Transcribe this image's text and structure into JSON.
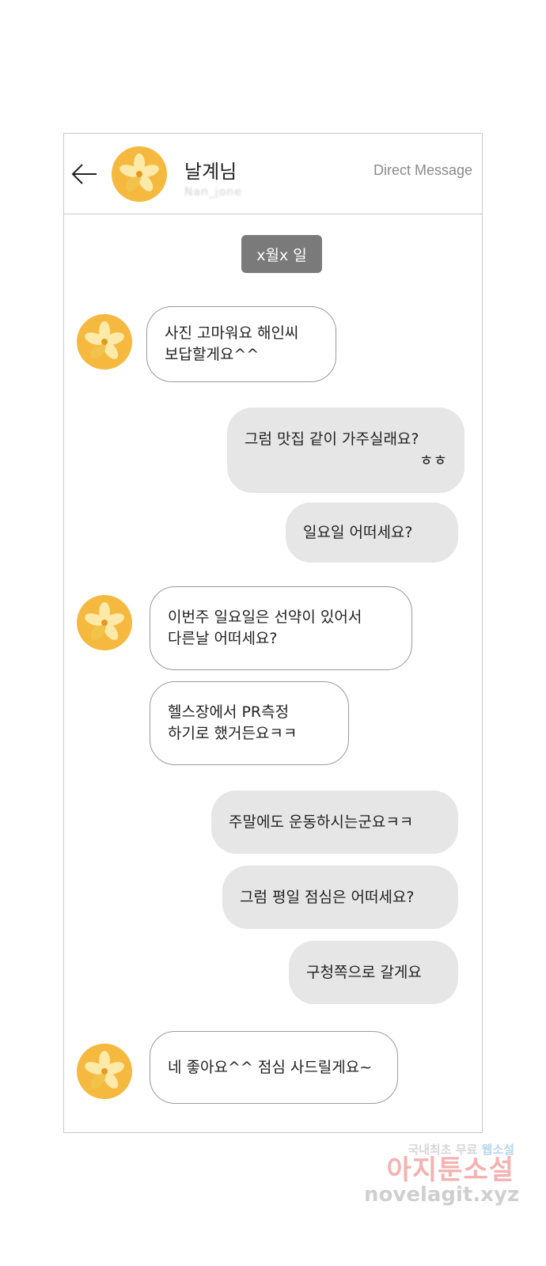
{
  "header": {
    "contact_name": "날계님",
    "contact_handle": "Nan_jone",
    "label": "Direct Message"
  },
  "date_chip": "x월x 일",
  "messages": [
    {
      "side": "in",
      "lines": [
        "사진 고마워요 해인씨",
        "보답할게요^^"
      ]
    },
    {
      "side": "out",
      "lines": [
        "그럼 맛집 같이 가주실래요?",
        "ㅎㅎ"
      ]
    },
    {
      "side": "out",
      "lines": [
        "일요일 어떠세요?"
      ]
    },
    {
      "side": "in",
      "lines": [
        "이번주 일요일은 선약이 있어서",
        "다른날 어떠세요?"
      ]
    },
    {
      "side": "in",
      "lines": [
        "헬스장에서 PR측정",
        "하기로 했거든요ㅋㅋ"
      ]
    },
    {
      "side": "out",
      "lines": [
        "주말에도 운동하시는군요ㅋㅋ"
      ]
    },
    {
      "side": "out",
      "lines": [
        "그럼 평일 점심은 어떠세요?"
      ]
    },
    {
      "side": "out",
      "lines": [
        "구청쪽으로 갈게요"
      ]
    },
    {
      "side": "in",
      "lines": [
        "네 좋아요^^ 점심 사드릴게요~"
      ]
    }
  ],
  "watermark": {
    "line1_a": "국내최초 무료 ",
    "line1_b": "웹소설",
    "line2": "아지툰소설",
    "line3": "novelagit.xyz"
  },
  "colors": {
    "avatar": "#f5b93f",
    "outgoing_bubble": "#e6e6e6",
    "date_chip": "#7a7a7a"
  }
}
